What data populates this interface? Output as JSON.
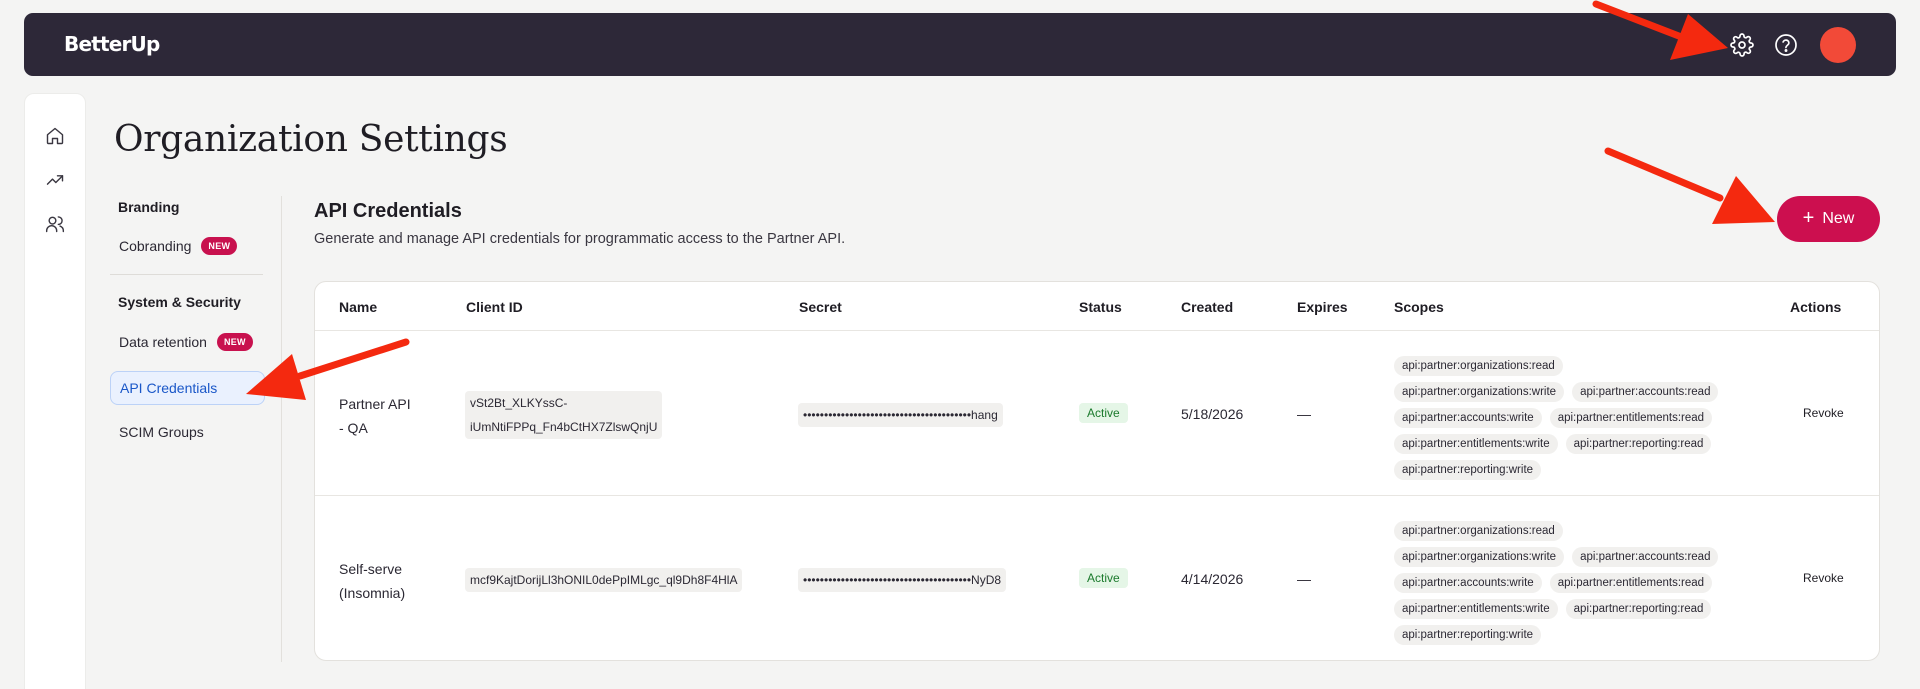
{
  "header": {
    "logo": "BetterUp",
    "icons": [
      "gear-icon",
      "help-icon"
    ]
  },
  "rail": {
    "icons": [
      "home-icon",
      "trending-up-icon",
      "users-icon"
    ]
  },
  "page": {
    "title": "Organization Settings"
  },
  "nav": {
    "branding_label": "Branding",
    "cobranding": "Cobranding",
    "new_badge": "NEW",
    "system_label": "System & Security",
    "data_retention": "Data retention",
    "api_credentials": "API Credentials",
    "scim_groups": "SCIM Groups"
  },
  "section": {
    "title": "API Credentials",
    "description": "Generate and manage API credentials for programmatic access to the Partner API.",
    "new_button": "New",
    "new_button_icon": "+"
  },
  "table": {
    "headers": [
      "Name",
      "Client ID",
      "Secret",
      "Status",
      "Created",
      "Expires",
      "Scopes",
      "Actions"
    ],
    "rows": [
      {
        "name_line1": "Partner API",
        "name_line2": "- QA",
        "client_id_line1": "vSt2Bt_XLKYssC-",
        "client_id_line2": "iUmNtiFPPq_Fn4bCtHX7ZlswQnjU",
        "secret": "••••••••••••••••••••••••••••••••••••••••hang",
        "status": "Active",
        "created": "5/18/2026",
        "expires": "—",
        "scopes": [
          "api:partner:organizations:read",
          "api:partner:organizations:write",
          "api:partner:accounts:read",
          "api:partner:accounts:write",
          "api:partner:entitlements:read",
          "api:partner:entitlements:write",
          "api:partner:reporting:read",
          "api:partner:reporting:write"
        ],
        "action": "Revoke"
      },
      {
        "name_line1": "Self-serve",
        "name_line2": "(Insomnia)",
        "client_id": "mcf9KajtDorijLl3hONIL0dePpIMLgc_ql9Dh8F4HlA",
        "secret": "••••••••••••••••••••••••••••••••••••••••NyD8",
        "status": "Active",
        "created": "4/14/2026",
        "expires": "—",
        "scopes": [
          "api:partner:organizations:read",
          "api:partner:organizations:write",
          "api:partner:accounts:read",
          "api:partner:accounts:write",
          "api:partner:entitlements:read",
          "api:partner:entitlements:write",
          "api:partner:reporting:read",
          "api:partner:reporting:write"
        ],
        "action": "Revoke"
      }
    ]
  },
  "colors": {
    "topbar": "#2d2838",
    "accent": "#cc0f4f",
    "annotation_arrow": "#f4290f",
    "active_status": "#1b7a2c"
  }
}
